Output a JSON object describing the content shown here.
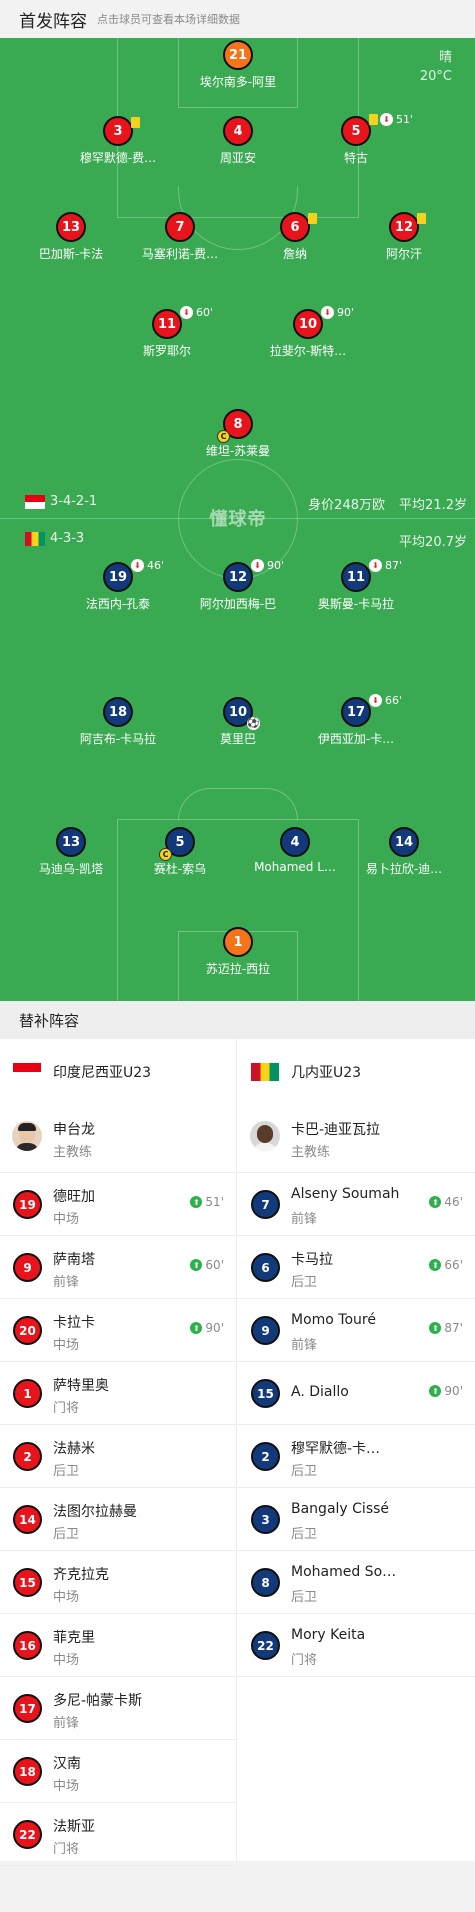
{
  "header": {
    "title": "首发阵容",
    "subtitle": "点击球员可查看本场详细数据"
  },
  "weather": {
    "condition": "晴",
    "temp": "20°C"
  },
  "watermark": "懂球帝",
  "home": {
    "formation": "3-4-2-1",
    "value": "身价248万欧",
    "avg_age": "平均21.2岁"
  },
  "away": {
    "formation": "4-3-3",
    "avg_age": "平均20.7岁"
  },
  "home_players": [
    {
      "num": "21",
      "name": "埃尔南多-阿里",
      "color": "orange"
    },
    {
      "num": "3",
      "name": "穆罕默德-费…",
      "color": "red",
      "yellow": true
    },
    {
      "num": "4",
      "name": "周亚安",
      "color": "red"
    },
    {
      "num": "5",
      "name": "特古",
      "color": "red",
      "yellow": true,
      "sub": "51'"
    },
    {
      "num": "13",
      "name": "巴加斯-卡法",
      "color": "red"
    },
    {
      "num": "7",
      "name": "马塞利诺-费…",
      "color": "red"
    },
    {
      "num": "6",
      "name": "詹纳",
      "color": "red",
      "yellow": true
    },
    {
      "num": "12",
      "name": "阿尔汗",
      "color": "red",
      "yellow": true
    },
    {
      "num": "11",
      "name": "斯罗耶尔",
      "color": "red",
      "sub": "60'"
    },
    {
      "num": "10",
      "name": "拉斐尔-斯特…",
      "color": "red",
      "sub": "90'"
    },
    {
      "num": "8",
      "name": "维坦-苏莱曼",
      "color": "red",
      "captain": true
    }
  ],
  "away_players": [
    {
      "num": "19",
      "name": "法西内-孔泰",
      "color": "navy",
      "sub": "46'"
    },
    {
      "num": "12",
      "name": "阿尔加西梅-巴",
      "color": "navy",
      "sub": "90'"
    },
    {
      "num": "11",
      "name": "奥斯曼-卡马拉",
      "color": "navy",
      "sub": "87'"
    },
    {
      "num": "18",
      "name": "阿吉布-卡马拉",
      "color": "navy"
    },
    {
      "num": "10",
      "name": "莫里巴",
      "color": "navy",
      "goal": true
    },
    {
      "num": "17",
      "name": "伊西亚加-卡…",
      "color": "navy",
      "sub": "66'"
    },
    {
      "num": "13",
      "name": "马迪乌-凯塔",
      "color": "navy"
    },
    {
      "num": "5",
      "name": "赛杜-索乌",
      "color": "navy",
      "captain": true
    },
    {
      "num": "4",
      "name": "Mohamed L…",
      "color": "navy"
    },
    {
      "num": "14",
      "name": "易卜拉欣-迪…",
      "color": "navy"
    },
    {
      "num": "1",
      "name": "苏迈拉-西拉",
      "color": "orange"
    }
  ],
  "subs_title": "替补阵容",
  "bench_home": {
    "team": "印度尼西亚U23",
    "coach": {
      "name": "申台龙",
      "role": "主教练"
    },
    "players": [
      {
        "num": "19",
        "name": "德旺加",
        "pos": "中场",
        "in": "51'"
      },
      {
        "num": "9",
        "name": "萨南塔",
        "pos": "前锋",
        "in": "60'"
      },
      {
        "num": "20",
        "name": "卡拉卡",
        "pos": "中场",
        "in": "90'"
      },
      {
        "num": "1",
        "name": "萨特里奥",
        "pos": "门将"
      },
      {
        "num": "2",
        "name": "法赫米",
        "pos": "后卫"
      },
      {
        "num": "14",
        "name": "法图尔拉赫曼",
        "pos": "后卫"
      },
      {
        "num": "15",
        "name": "齐克拉克",
        "pos": "中场"
      },
      {
        "num": "16",
        "name": "菲克里",
        "pos": "中场"
      },
      {
        "num": "17",
        "name": "多尼-帕蒙卡斯",
        "pos": "前锋"
      },
      {
        "num": "18",
        "name": "汉南",
        "pos": "中场"
      },
      {
        "num": "22",
        "name": "法斯亚",
        "pos": "门将"
      }
    ]
  },
  "bench_away": {
    "team": "几内亚U23",
    "coach": {
      "name": "卡巴-迪亚瓦拉",
      "role": "主教练"
    },
    "players": [
      {
        "num": "7",
        "name": "Alseny Soumah",
        "pos": "前锋",
        "in": "46'"
      },
      {
        "num": "6",
        "name": "卡马拉",
        "pos": "后卫",
        "in": "66'"
      },
      {
        "num": "9",
        "name": "Momo Touré",
        "pos": "前锋",
        "in": "87'"
      },
      {
        "num": "15",
        "name": "A. Diallo",
        "pos": "",
        "in": "90'"
      },
      {
        "num": "2",
        "name": "穆罕默德-卡…",
        "pos": "后卫"
      },
      {
        "num": "3",
        "name": "Bangaly Cissé",
        "pos": "后卫"
      },
      {
        "num": "8",
        "name": "Mohamed So…",
        "pos": "后卫"
      },
      {
        "num": "22",
        "name": "Mory Keita",
        "pos": "门将"
      }
    ]
  }
}
